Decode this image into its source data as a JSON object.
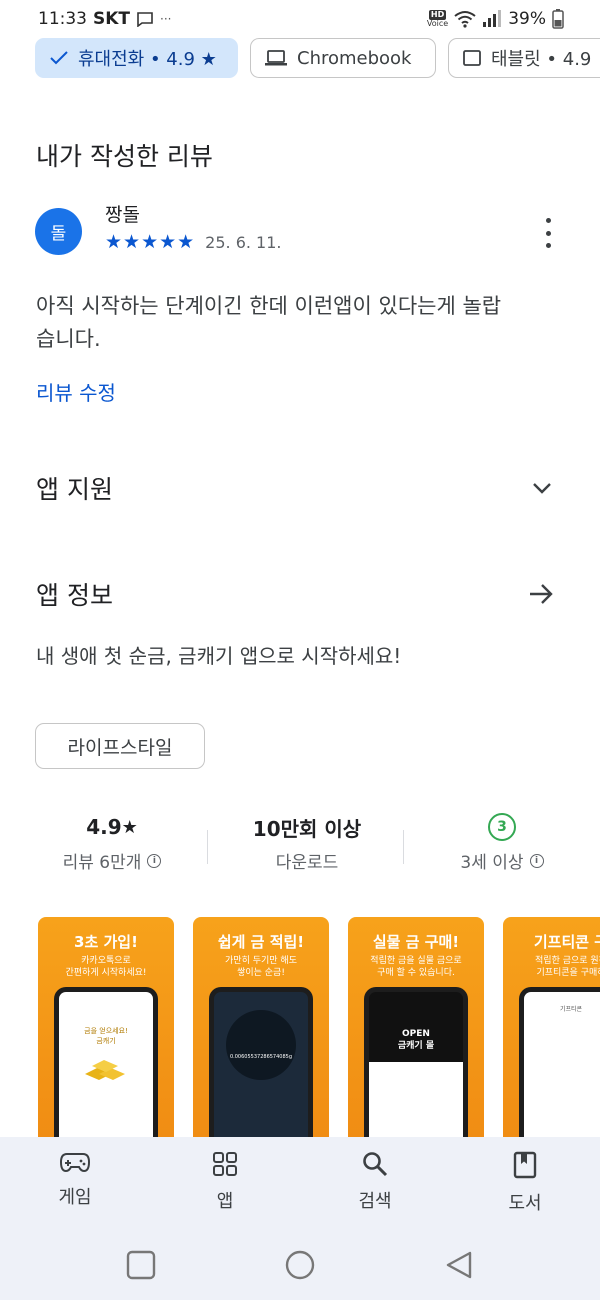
{
  "status_bar": {
    "time": "11:33",
    "carrier": "SKT",
    "battery": "39%",
    "hd": "HD",
    "voice": "Voice"
  },
  "device_chips": [
    {
      "label": "휴대전화 • 4.9 ★",
      "selected": true
    },
    {
      "label": "Chromebook",
      "selected": false
    },
    {
      "label": "태블릿 • 4.9",
      "selected": false
    }
  ],
  "my_review": {
    "section_title": "내가 작성한 리뷰",
    "avatar_letter": "돌",
    "reviewer_name": "짱돌",
    "rating_stars": "★★★★★",
    "rating": 5,
    "date": "25. 6. 11.",
    "text": "아직 시작하는 단계이긴 한데 이런앱이 있다는게 놀랍습니다.",
    "edit_label": "리뷰 수정"
  },
  "app_support": {
    "label": "앱 지원"
  },
  "app_info": {
    "label": "앱 정보",
    "description": "내 생애 첫 순금, 금캐기 앱으로 시작하세요!",
    "category_tag": "라이프스타일"
  },
  "stats": {
    "rating_value": "4.9",
    "rating_star": "★",
    "reviews_label": "리뷰 6만개",
    "downloads_value": "10만회 이상",
    "downloads_label": "다운로드",
    "age_badge": "3",
    "age_label": "3세 이상"
  },
  "screenshots": [
    {
      "title": "3초 가입!",
      "subtitle": "카카오톡으로\n간편하게 시작하세요!",
      "screen_text": "금을 얻으세요!\n금캐기"
    },
    {
      "title": "쉽게 금 적립!",
      "subtitle": "가만히 두기만 해도\n쌓이는 순금!",
      "screen_text": "0.00605537286574085g"
    },
    {
      "title": "실물 금 구매!",
      "subtitle": "적립한 금을 실물 금으로\n구매 할 수 있습니다.",
      "screen_text": "OPEN\n금캐기 몰"
    },
    {
      "title": "기프티콘 구",
      "subtitle": "적립한 금으로 원하\n기프티콘을 구매하",
      "screen_text": "기프티콘"
    }
  ],
  "bottom_nav": [
    {
      "label": "게임",
      "icon": "gamepad-icon"
    },
    {
      "label": "앱",
      "icon": "apps-grid-icon"
    },
    {
      "label": "검색",
      "icon": "search-icon"
    },
    {
      "label": "도서",
      "icon": "book-icon"
    }
  ],
  "colors": {
    "accent": "#0b57d0",
    "chip_selected_bg": "#d3e6fb",
    "screenshot_orange": "#f39a17",
    "age_green": "#34a853"
  }
}
